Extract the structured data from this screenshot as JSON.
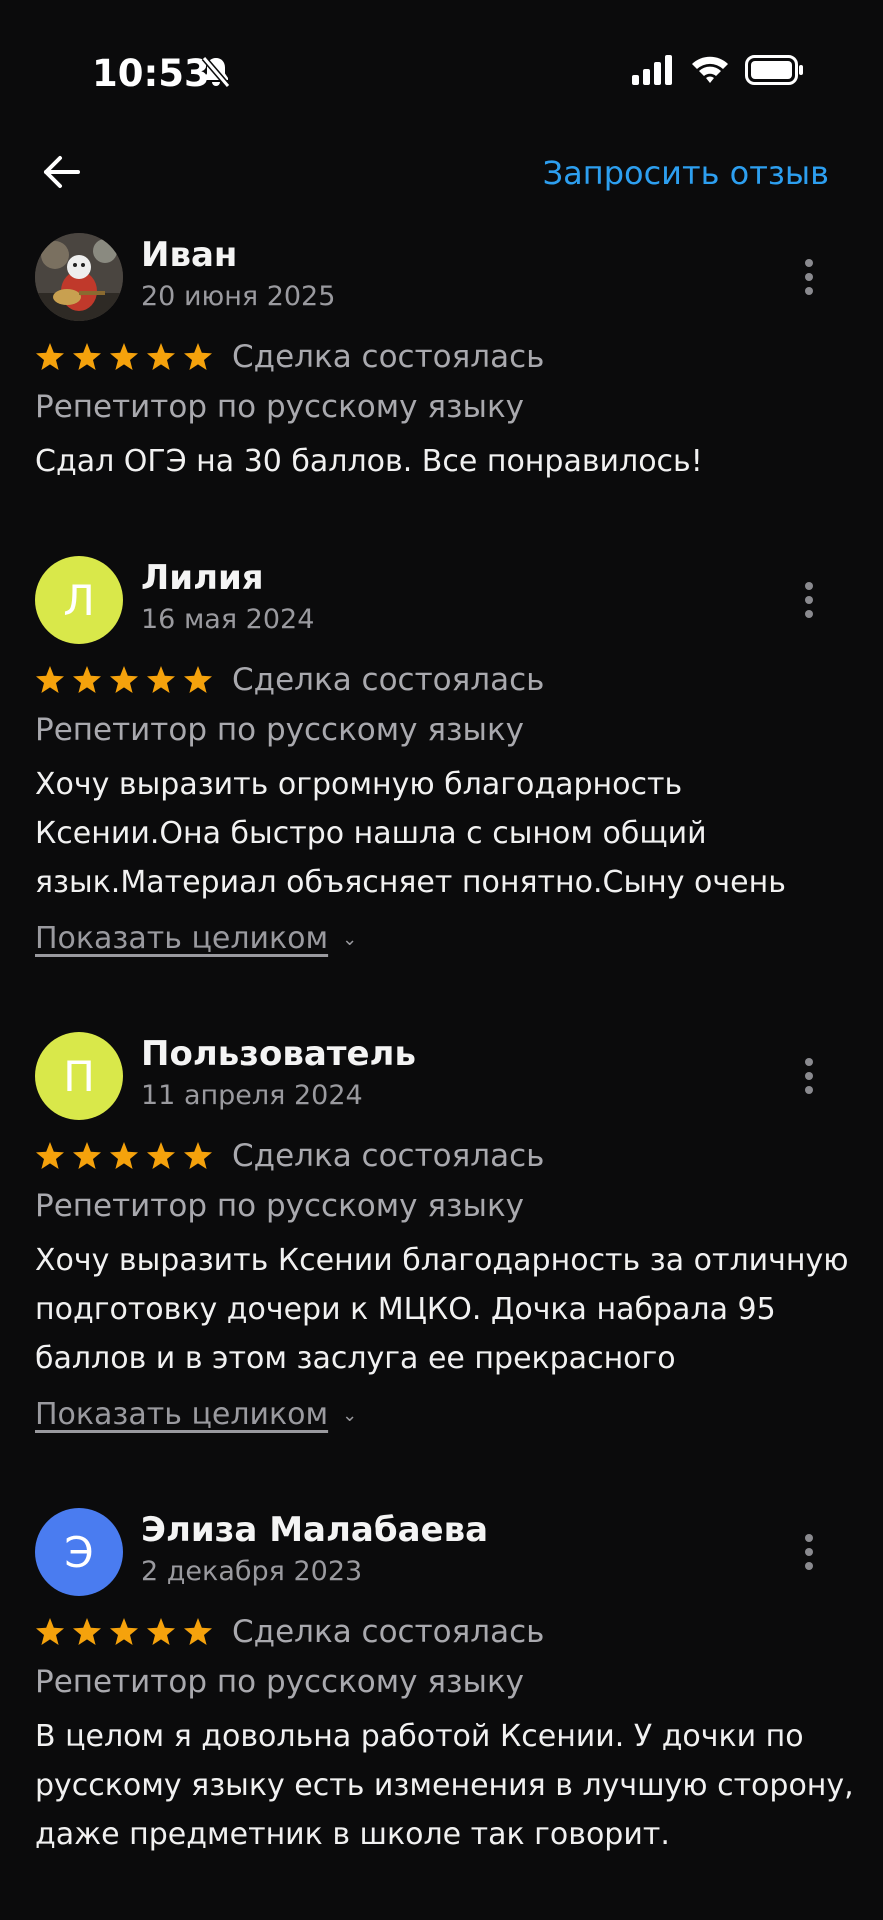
{
  "status_bar": {
    "time": "10:53"
  },
  "header": {
    "request_label": "Запросить отзыв"
  },
  "colors": {
    "accent": "#2d9ff0",
    "star": "#f5a20c",
    "avatar_lime": "#d9e84a",
    "avatar_blue": "#4a7cf0"
  },
  "reviews": [
    {
      "name": "Иван",
      "date": "20 июня 2025",
      "rating": 5,
      "deal": "Сделка состоялась",
      "subject": "Репетитор по русскому языку",
      "lines": [
        "Сдал ОГЭ на 30 баллов. Все понравилось!"
      ],
      "show_more": ""
    },
    {
      "name": "Лилия",
      "initial": "Л",
      "date": "16 мая 2024",
      "rating": 5,
      "deal": "Сделка состоялась",
      "subject": "Репетитор по русскому языку",
      "lines": [
        "Хочу выразить огромную благодарность",
        "Ксении.Она быстро нашла с сыном общий",
        "язык.Материал объясняет понятно.Сыну очень"
      ],
      "show_more": "Показать целиком"
    },
    {
      "name": "Пользователь",
      "initial": "П",
      "date": "11 апреля 2024",
      "rating": 5,
      "deal": "Сделка состоялась",
      "subject": "Репетитор по русскому языку",
      "lines": [
        "Хочу выразить Ксении благодарность за отличную",
        "подготовку дочери к МЦКО. Дочка набрала 95",
        "баллов и в этом заслуга ее прекрасного"
      ],
      "show_more": "Показать целиком"
    },
    {
      "name": "Элиза Малабаева",
      "initial": "Э",
      "date": "2 декабря 2023",
      "rating": 5,
      "deal": "Сделка состоялась",
      "subject": "Репетитор по русскому языку",
      "lines": [
        "В целом я довольна работой Ксении. У дочки по",
        "русскому языку есть изменения в лучшую сторону,",
        "даже предметник в школе так говорит."
      ],
      "show_more": ""
    }
  ]
}
